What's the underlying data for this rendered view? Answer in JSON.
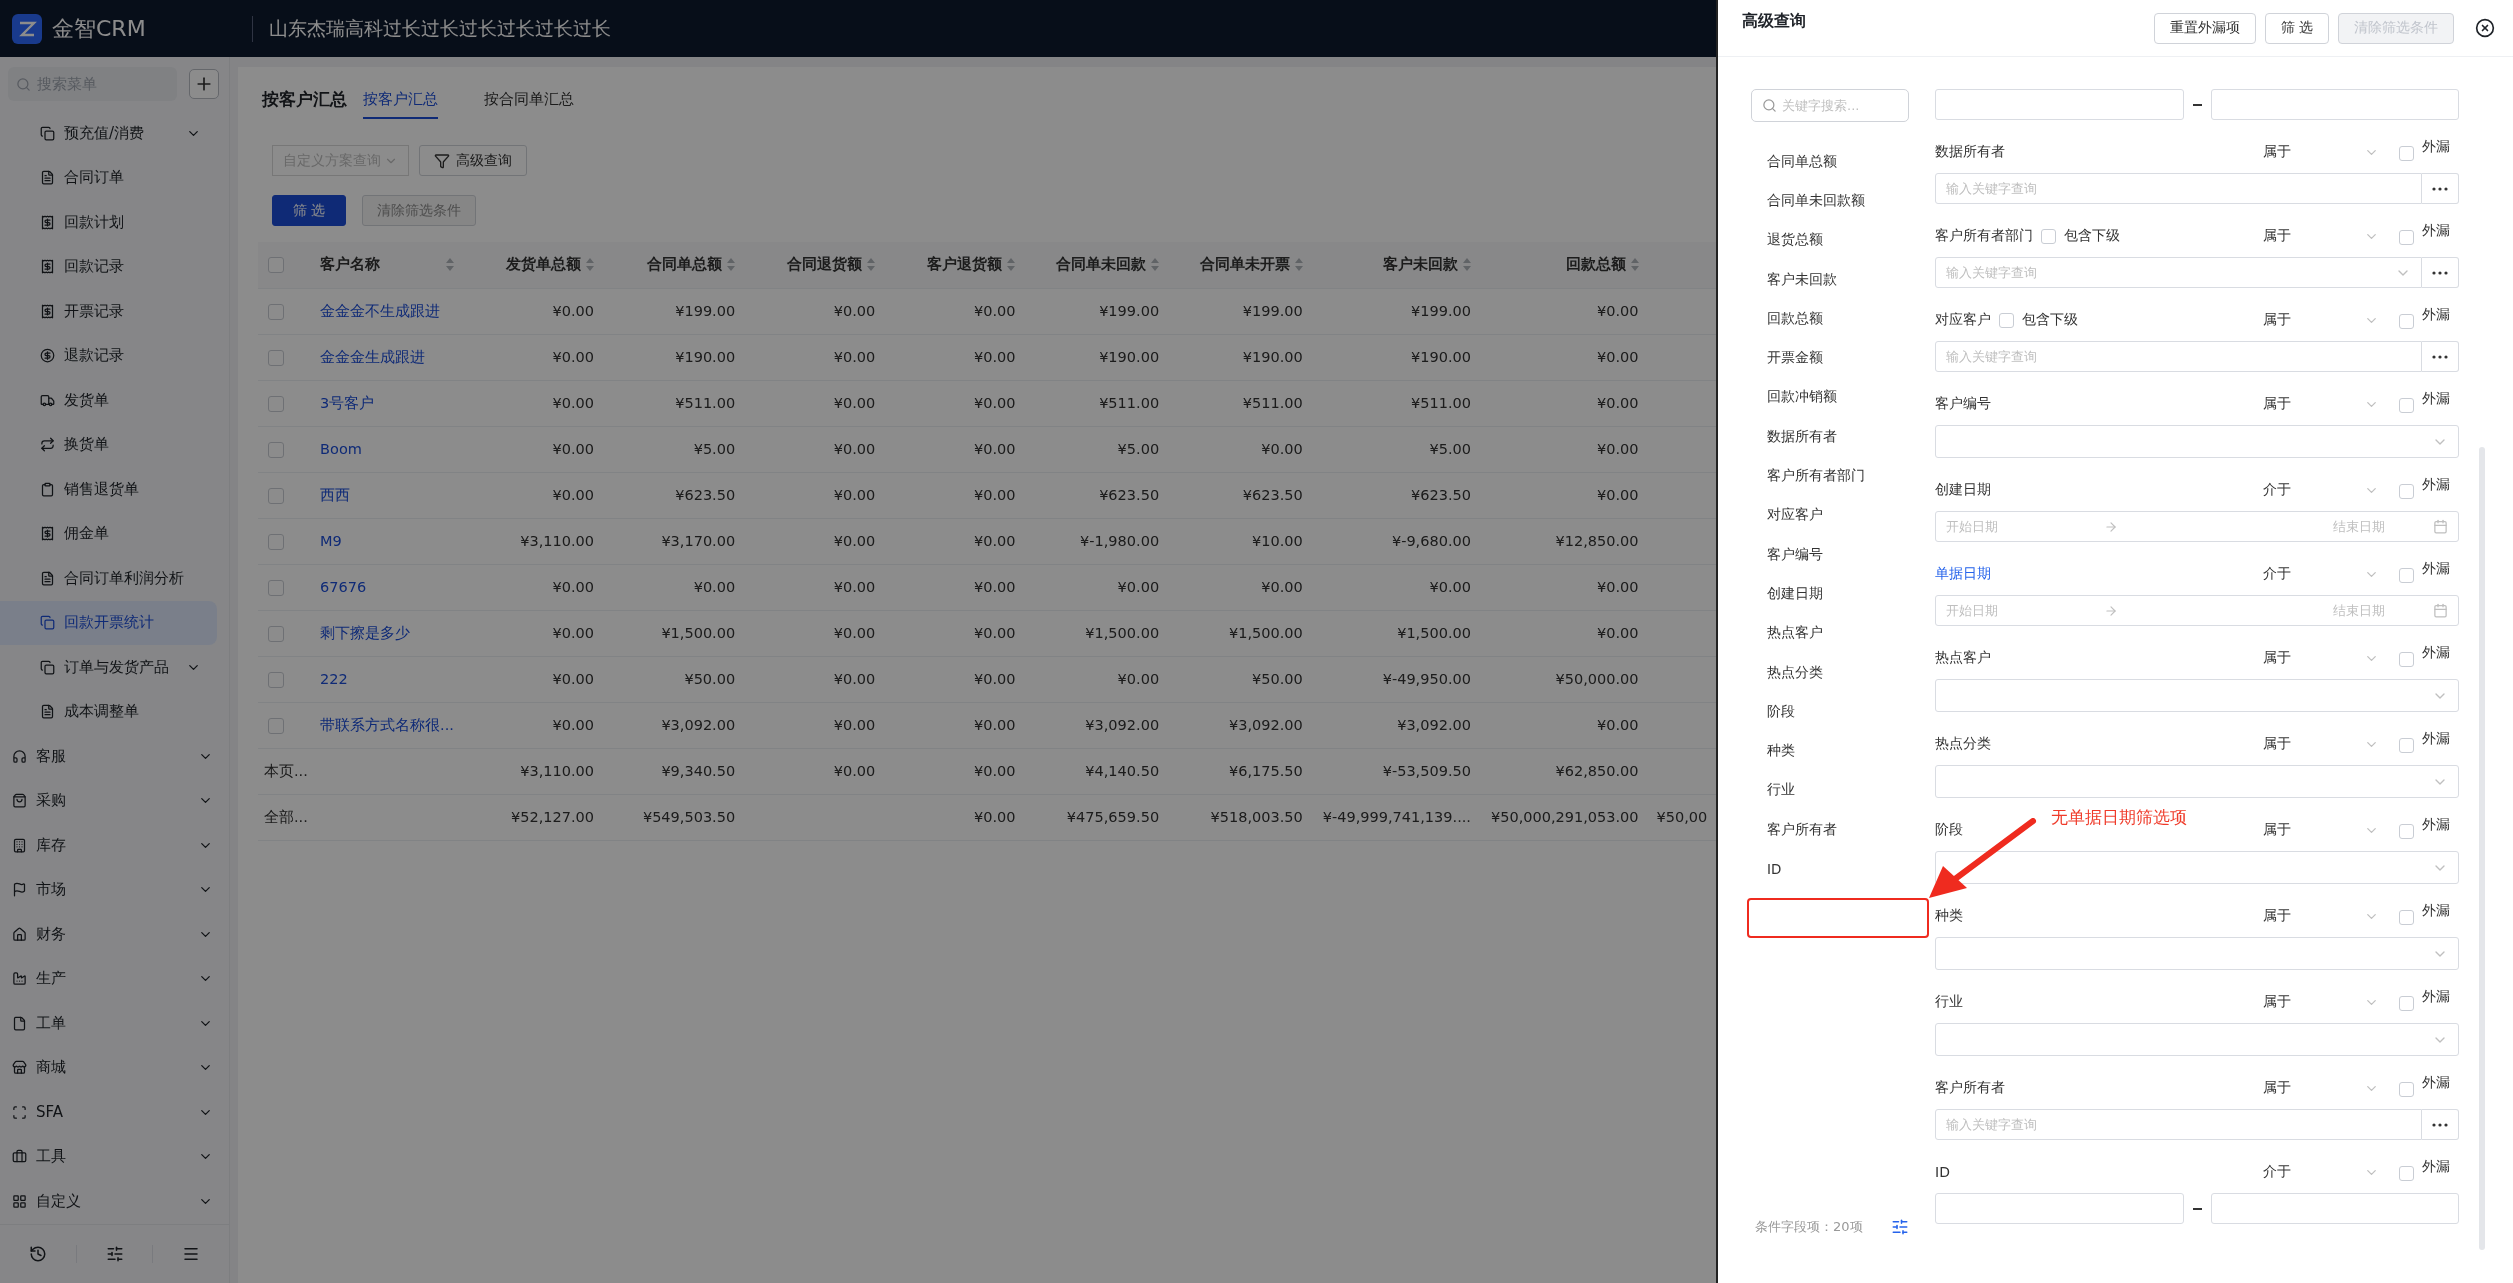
{
  "header": {
    "logo_text": "金智CRM",
    "title": "山东杰瑞高科过长过长过长过长过长过长"
  },
  "sidebar": {
    "search": {
      "placeholder": "搜索菜单"
    },
    "sub_items": [
      {
        "label": "预充值/消费",
        "expandable": true,
        "selected": false
      },
      {
        "label": "合同订单",
        "expandable": false,
        "selected": false
      },
      {
        "label": "回款计划",
        "expandable": false,
        "selected": false
      },
      {
        "label": "回款记录",
        "expandable": false,
        "selected": false
      },
      {
        "label": "开票记录",
        "expandable": false,
        "selected": false
      },
      {
        "label": "退款记录",
        "expandable": false,
        "selected": false
      },
      {
        "label": "发货单",
        "expandable": false,
        "selected": false
      },
      {
        "label": "换货单",
        "expandable": false,
        "selected": false
      },
      {
        "label": "销售退货单",
        "expandable": false,
        "selected": false
      },
      {
        "label": "佣金单",
        "expandable": false,
        "selected": false
      },
      {
        "label": "合同订单利润分析",
        "expandable": false,
        "selected": false
      },
      {
        "label": "回款开票统计",
        "expandable": false,
        "selected": true
      },
      {
        "label": "订单与发货产品",
        "expandable": true,
        "selected": false
      },
      {
        "label": "成本调整单",
        "expandable": false,
        "selected": false
      }
    ],
    "groups": [
      {
        "label": "客服",
        "expandable": true
      },
      {
        "label": "采购",
        "expandable": true
      },
      {
        "label": "库存",
        "expandable": true
      },
      {
        "label": "市场",
        "expandable": true
      },
      {
        "label": "财务",
        "expandable": true
      },
      {
        "label": "生产",
        "expandable": true
      },
      {
        "label": "工单",
        "expandable": true
      },
      {
        "label": "商城",
        "expandable": true
      },
      {
        "label": "SFA",
        "expandable": true
      },
      {
        "label": "工具",
        "expandable": true
      },
      {
        "label": "自定义",
        "expandable": true
      }
    ]
  },
  "page": {
    "title": "按客户汇总",
    "tabs": [
      {
        "label": "按客户汇总",
        "selected": true
      },
      {
        "label": "按合同单汇总",
        "selected": false
      }
    ],
    "scheme_select": {
      "placeholder": "自定义方案查询"
    },
    "advanced_button": "高级查询",
    "filter_button": {
      "label": "筛 选",
      "disabled": false
    },
    "clear_button": {
      "label": "清除筛选条件",
      "disabled": true
    }
  },
  "table": {
    "all_checked": false,
    "columns": [
      {
        "label": "客户名称",
        "sortable": true
      },
      {
        "label": "发货单总额",
        "sortable": true
      },
      {
        "label": "合同单总额",
        "sortable": true
      },
      {
        "label": "合同退货额",
        "sortable": true
      },
      {
        "label": "客户退货额",
        "sortable": true
      },
      {
        "label": "合同单未回款",
        "sortable": true
      },
      {
        "label": "合同单未开票",
        "sortable": true
      },
      {
        "label": "客户未回款",
        "sortable": true
      },
      {
        "label": "回款总额",
        "sortable": true
      }
    ],
    "rows": [
      {
        "checked": false,
        "name": "金金金不生成跟进",
        "values": [
          "¥0.00",
          "¥199.00",
          "¥0.00",
          "¥0.00",
          "¥199.00",
          "¥199.00",
          "¥199.00",
          "¥0.00"
        ]
      },
      {
        "checked": false,
        "name": "金金金生成跟进",
        "values": [
          "¥0.00",
          "¥190.00",
          "¥0.00",
          "¥0.00",
          "¥190.00",
          "¥190.00",
          "¥190.00",
          "¥0.00"
        ]
      },
      {
        "checked": false,
        "name": "3号客户",
        "values": [
          "¥0.00",
          "¥511.00",
          "¥0.00",
          "¥0.00",
          "¥511.00",
          "¥511.00",
          "¥511.00",
          "¥0.00"
        ]
      },
      {
        "checked": false,
        "name": "Boom",
        "values": [
          "¥0.00",
          "¥5.00",
          "¥0.00",
          "¥0.00",
          "¥5.00",
          "¥0.00",
          "¥5.00",
          "¥0.00"
        ]
      },
      {
        "checked": false,
        "name": "西西",
        "values": [
          "¥0.00",
          "¥623.50",
          "¥0.00",
          "¥0.00",
          "¥623.50",
          "¥623.50",
          "¥623.50",
          "¥0.00"
        ]
      },
      {
        "checked": false,
        "name": "M9",
        "values": [
          "¥3,110.00",
          "¥3,170.00",
          "¥0.00",
          "¥0.00",
          "¥-1,980.00",
          "¥10.00",
          "¥-9,680.00",
          "¥12,850.00"
        ]
      },
      {
        "checked": false,
        "name": "67676",
        "values": [
          "¥0.00",
          "¥0.00",
          "¥0.00",
          "¥0.00",
          "¥0.00",
          "¥0.00",
          "¥0.00",
          "¥0.00"
        ]
      },
      {
        "checked": false,
        "name": "剩下擦是多少",
        "values": [
          "¥0.00",
          "¥1,500.00",
          "¥0.00",
          "¥0.00",
          "¥1,500.00",
          "¥1,500.00",
          "¥1,500.00",
          "¥0.00"
        ]
      },
      {
        "checked": false,
        "name": "222",
        "values": [
          "¥0.00",
          "¥50.00",
          "¥0.00",
          "¥0.00",
          "¥0.00",
          "¥50.00",
          "¥-49,950.00",
          "¥50,000.00"
        ]
      },
      {
        "checked": false,
        "name": "带联系方式名称很...",
        "values": [
          "¥0.00",
          "¥3,092.00",
          "¥0.00",
          "¥0.00",
          "¥3,092.00",
          "¥3,092.00",
          "¥3,092.00",
          "¥0.00"
        ]
      }
    ],
    "summary_rows": [
      {
        "label": "本页...",
        "cells": [
          {
            "value": "¥3,110.00"
          },
          {
            "value": "¥9,340.50"
          },
          {
            "value": "¥0.00"
          },
          {
            "value": "¥0.00"
          },
          {
            "value": "¥4,140.50"
          },
          {
            "value": "¥6,175.50"
          },
          {
            "value": "¥-53,509.50"
          },
          {
            "value": "¥62,850.00"
          }
        ]
      },
      {
        "label": "全部...",
        "cells": [
          {
            "value": "¥52,127.00"
          },
          {
            "value": "¥549,503.50"
          },
          {
            "blank": true
          },
          {
            "value": "¥0.00"
          },
          {
            "value": "¥475,659.50"
          },
          {
            "value": "¥518,003.50"
          },
          {
            "value": "¥-49,999,741,139...."
          },
          {
            "value": "¥50,000,291,053.00"
          }
        ],
        "column_10": "¥50,00"
      }
    ]
  },
  "drawer": {
    "title": "高级查询",
    "buttons": [
      {
        "label": "重置外漏项",
        "disabled": false
      },
      {
        "label": "筛 选",
        "disabled": false
      },
      {
        "label": "清除筛选条件",
        "disabled": true
      }
    ],
    "search": {
      "placeholder": "关键字搜索..."
    },
    "field_list": [
      "合同单总额",
      "合同单未回款额",
      "退货总额",
      "客户未回款",
      "回款总额",
      "开票金额",
      "回款冲销额",
      "数据所有者",
      "客户所有者部门",
      "对应客户",
      "客户编号",
      "创建日期",
      "热点客户",
      "热点分类",
      "阶段",
      "种类",
      "行业",
      "客户所有者",
      "ID"
    ],
    "field_count": "条件字段项：20项",
    "fields": [
      {
        "kind": "range"
      },
      {
        "kind": "picker",
        "label": "数据所有者",
        "highlighted": false,
        "operator": "属于",
        "exclude_label": "外漏",
        "excluded": false,
        "placeholder": "输入关键字查询"
      },
      {
        "kind": "tree_picker",
        "label": "客户所有者部门",
        "highlighted": false,
        "include_children": {
          "label": "包含下级",
          "checked": false
        },
        "operator": "属于",
        "exclude_label": "外漏",
        "excluded": false,
        "placeholder": "输入关键字查询"
      },
      {
        "kind": "picker",
        "label": "对应客户",
        "highlighted": false,
        "include_children": {
          "label": "包含下级",
          "checked": false
        },
        "operator": "属于",
        "exclude_label": "外漏",
        "excluded": false,
        "placeholder": "输入关键字查询"
      },
      {
        "kind": "select",
        "label": "客户编号",
        "highlighted": false,
        "operator": "属于",
        "exclude_label": "外漏",
        "excluded": false
      },
      {
        "kind": "date_range",
        "label": "创建日期",
        "highlighted": false,
        "operator": "介于",
        "exclude_label": "外漏",
        "excluded": false,
        "start_placeholder": "开始日期",
        "end_placeholder": "结束日期"
      },
      {
        "kind": "date_range",
        "label": "单据日期",
        "highlighted": true,
        "operator": "介于",
        "exclude_label": "外漏",
        "excluded": false,
        "start_placeholder": "开始日期",
        "end_placeholder": "结束日期"
      },
      {
        "kind": "select",
        "label": "热点客户",
        "highlighted": false,
        "operator": "属于",
        "exclude_label": "外漏",
        "excluded": false
      },
      {
        "kind": "select",
        "label": "热点分类",
        "highlighted": false,
        "operator": "属于",
        "exclude_label": "外漏",
        "excluded": false
      },
      {
        "kind": "select",
        "label": "阶段",
        "highlighted": false,
        "operator": "属于",
        "exclude_label": "外漏",
        "excluded": false
      },
      {
        "kind": "select",
        "label": "种类",
        "highlighted": false,
        "operator": "属于",
        "exclude_label": "外漏",
        "excluded": false
      },
      {
        "kind": "select",
        "label": "行业",
        "highlighted": false,
        "operator": "属于",
        "exclude_label": "外漏",
        "excluded": false
      },
      {
        "kind": "picker",
        "label": "客户所有者",
        "highlighted": false,
        "operator": "属于",
        "exclude_label": "外漏",
        "excluded": false,
        "placeholder": "输入关键字查询"
      },
      {
        "kind": "range",
        "label": "ID",
        "highlighted": false,
        "operator": "介于",
        "exclude_label": "外漏",
        "excluded": false
      }
    ]
  },
  "annotation": {
    "text": "无单据日期筛选项"
  }
}
